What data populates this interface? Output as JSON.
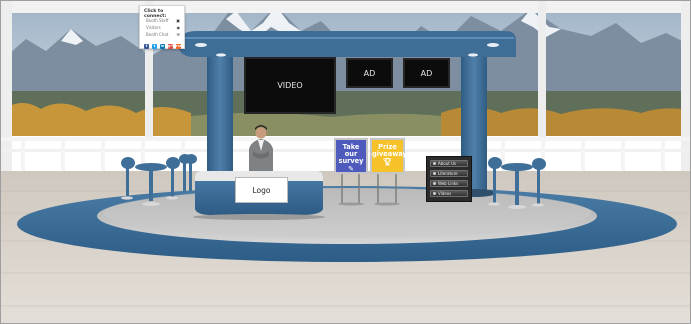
{
  "connect_panel": {
    "title": "Click to connect:",
    "rows": [
      {
        "label": "Booth Staff",
        "icon": "people-icon"
      },
      {
        "label": "Visitors",
        "icon": "eye-icon"
      },
      {
        "label": "Booth Chat",
        "icon": "chat-icon"
      }
    ],
    "social": [
      {
        "label": "f",
        "icon": "facebook-icon",
        "color": "#3b5998"
      },
      {
        "label": "t",
        "icon": "twitter-icon",
        "color": "#1da1f2"
      },
      {
        "label": "in",
        "icon": "linkedin-icon",
        "color": "#0077b5"
      },
      {
        "label": "g+",
        "icon": "googleplus-icon",
        "color": "#dd4b39"
      },
      {
        "label": "rss",
        "icon": "rss-icon",
        "color": "#f26522"
      }
    ]
  },
  "screens": {
    "video": "VIDEO",
    "ad_1": "AD",
    "ad_2": "AD"
  },
  "booth": {
    "logo": "Logo"
  },
  "posters": {
    "survey": {
      "line1": "Take our",
      "line2": "survey",
      "color": "#4e5bbd",
      "icon": "pencil-icon"
    },
    "prize": {
      "line1": "Prize",
      "line2": "giveaway",
      "color": "#f6c22a",
      "icon": "trophy-icon"
    }
  },
  "kiosk": {
    "buttons": [
      "About Us",
      "Literature",
      "Web Links",
      "Videos"
    ]
  },
  "colors": {
    "booth_blue": "#3e6e96",
    "floor_ring": "#3d6f9a",
    "floor_inner": "#bdbdbd"
  }
}
